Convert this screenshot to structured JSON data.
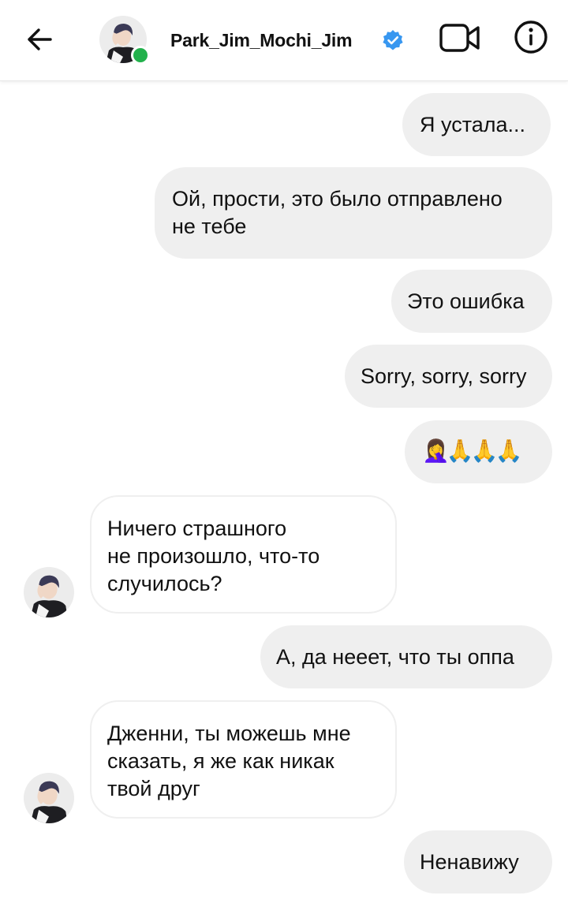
{
  "header": {
    "username": "Park_Jim_Mochi_Jim",
    "back_icon": "arrow-left-icon",
    "verified_icon": "verified-badge-icon",
    "video_icon": "video-camera-icon",
    "info_icon": "info-icon",
    "online": true,
    "online_color": "#22b14c",
    "verified_color": "#3897f0"
  },
  "messages": [
    {
      "side": "sent",
      "text": "Я устала..."
    },
    {
      "side": "sent",
      "text": "Ой, прости, это было отправлено\nне тебе"
    },
    {
      "side": "sent",
      "text": "Это ошибка"
    },
    {
      "side": "sent",
      "text": "Sorry, sorry, sorry"
    },
    {
      "side": "sent",
      "text": "🤦‍♀️🙏🙏🙏"
    },
    {
      "side": "received",
      "text": "Ничего страшного\nне произошло, что-то\nслучилось?"
    },
    {
      "side": "sent",
      "text": "А, да нееет, что ты оппа"
    },
    {
      "side": "received",
      "text": "Дженни, ты можешь мне\nсказать, я же как никак\nтвой друг"
    },
    {
      "side": "sent",
      "text": "Ненавижу"
    }
  ],
  "colors": {
    "sent_bubble": "#efefef",
    "received_border": "#efefef"
  }
}
